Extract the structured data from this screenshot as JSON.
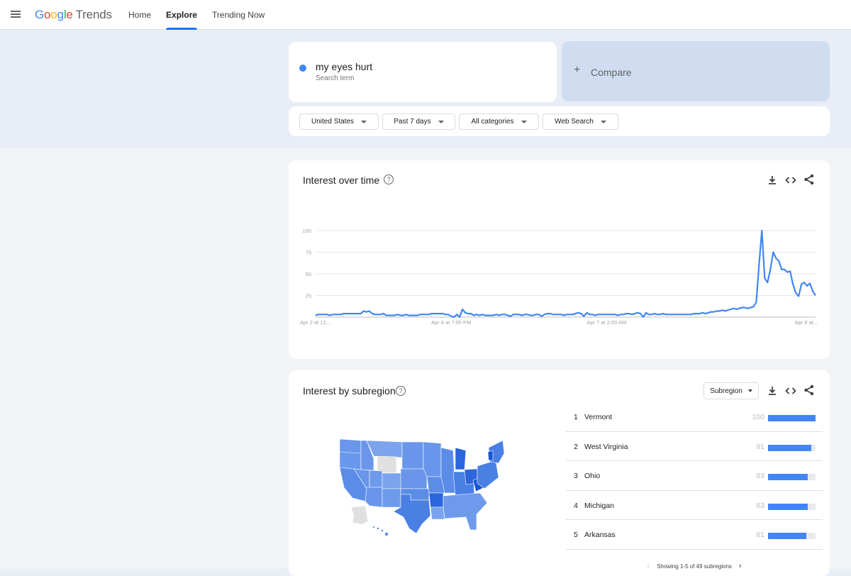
{
  "header": {
    "logo_google": [
      "G",
      "o",
      "o",
      "g",
      "l",
      "e"
    ],
    "logo_product": "Trends",
    "nav": [
      {
        "label": "Home",
        "active": false
      },
      {
        "label": "Explore",
        "active": true
      },
      {
        "label": "Trending Now",
        "active": false
      }
    ]
  },
  "search": {
    "term": "my eyes hurt",
    "term_type": "Search term",
    "term_color": "#4285f4",
    "compare_label": "Compare"
  },
  "filters": [
    {
      "label": "United States"
    },
    {
      "label": "Past 7 days"
    },
    {
      "label": "All categories"
    },
    {
      "label": "Web Search"
    }
  ],
  "interest_over_time": {
    "title": "Interest over time",
    "help": "?"
  },
  "interest_by_subregion": {
    "title": "Interest by subregion",
    "help": "?",
    "resolution": "Subregion",
    "rows": [
      {
        "rank": "1",
        "name": "Vermont",
        "value": 100
      },
      {
        "rank": "2",
        "name": "West Virginia",
        "value": 91
      },
      {
        "rank": "3",
        "name": "Ohio",
        "value": 83
      },
      {
        "rank": "4",
        "name": "Michigan",
        "value": 83
      },
      {
        "rank": "5",
        "name": "Arkansas",
        "value": 81
      }
    ],
    "pager": "Showing 1-5 of 49 subregions"
  },
  "chart_data": {
    "type": "line",
    "title": "Interest over time",
    "xlabel": "",
    "ylabel": "",
    "ylim": [
      0,
      100
    ],
    "yticks": [
      25,
      50,
      75,
      100
    ],
    "grid": true,
    "x_tick_labels": [
      {
        "label": "Apr 2 at 12...",
        "index": 0
      },
      {
        "label": "Apr 4 at 7:00 PM",
        "index": 48
      },
      {
        "label": "Apr 7 at 2:00 AM",
        "index": 103
      },
      {
        "label": "Apr 9 at...",
        "index": 167
      }
    ],
    "series": [
      {
        "name": "my eyes hurt",
        "color": "#4285f4",
        "values": [
          2,
          3,
          3,
          3,
          3,
          2,
          3,
          3,
          3,
          3,
          4,
          4,
          4,
          4,
          4,
          4,
          4,
          7,
          6,
          7,
          4,
          3,
          3,
          3,
          4,
          2,
          2,
          2,
          2,
          3,
          2,
          2,
          3,
          2,
          2,
          2,
          2,
          3,
          3,
          3,
          3,
          4,
          4,
          4,
          4,
          4,
          3,
          3,
          1,
          0,
          3,
          0,
          9,
          5,
          4,
          4,
          2,
          3,
          2,
          3,
          2,
          2,
          2,
          2,
          3,
          2,
          3,
          3,
          2,
          1,
          3,
          3,
          3,
          2,
          3,
          3,
          2,
          2,
          3,
          3,
          1,
          3,
          4,
          4,
          3,
          3,
          3,
          3,
          2,
          3,
          3,
          3,
          4,
          5,
          4,
          1,
          5,
          3,
          3,
          2,
          3,
          3,
          3,
          3,
          3,
          3,
          3,
          2,
          3,
          3,
          4,
          4,
          3,
          4,
          5,
          4,
          0,
          5,
          3,
          3,
          4,
          3,
          3,
          4,
          3,
          3,
          3,
          3,
          3,
          3,
          3,
          3,
          3,
          3,
          4,
          4,
          4,
          5,
          4,
          5,
          6,
          6,
          7,
          7,
          8,
          7,
          8,
          9,
          10,
          9,
          10,
          11,
          11,
          10,
          11,
          12,
          17,
          60,
          100,
          45,
          40,
          55,
          75,
          68,
          65,
          55,
          55,
          52,
          53,
          38,
          28,
          24,
          38,
          40,
          36,
          39,
          30,
          25
        ]
      }
    ]
  },
  "map": {
    "colors": {
      "low": "#b4c9f3",
      "mid": "#6996ea",
      "high": "#3b73e0",
      "top": "#1a56d6",
      "no_data": "#e0e0e0"
    }
  }
}
